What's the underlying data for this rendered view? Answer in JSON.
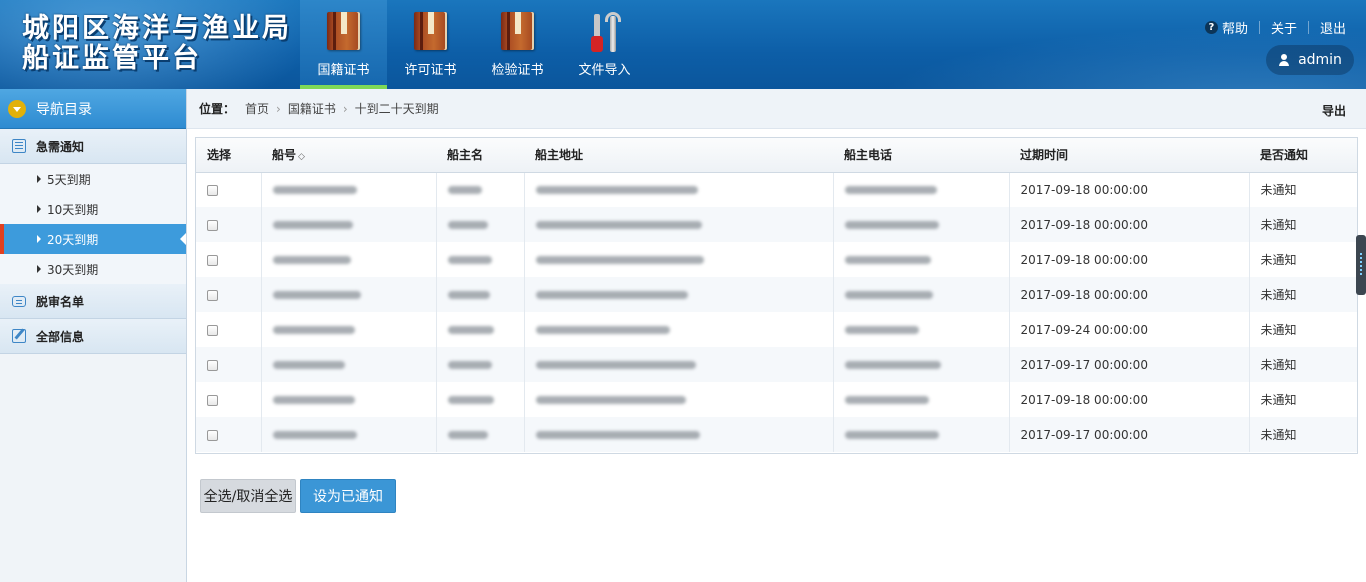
{
  "brand": {
    "line1": "城阳区海洋与渔业局",
    "line2": "船证监管平台"
  },
  "nav": [
    {
      "label": "国籍证书",
      "icon": "book-icon",
      "active": true
    },
    {
      "label": "许可证书",
      "icon": "book-icon",
      "active": false
    },
    {
      "label": "检验证书",
      "icon": "book-icon",
      "active": false
    },
    {
      "label": "文件导入",
      "icon": "tools-icon",
      "active": false
    }
  ],
  "top_links": {
    "help": "帮助",
    "about": "关于",
    "logout": "退出"
  },
  "user": {
    "name": "admin"
  },
  "sidebar": {
    "title": "导航目录",
    "groups": [
      {
        "label": "急需通知",
        "icon": "list-icon"
      },
      {
        "label": "脱审名单",
        "icon": "chat-icon"
      },
      {
        "label": "全部信息",
        "icon": "edit-icon"
      }
    ],
    "subs": [
      {
        "label": "5天到期"
      },
      {
        "label": "10天到期"
      },
      {
        "label": "20天到期"
      },
      {
        "label": "30天到期"
      }
    ]
  },
  "breadcrumb": {
    "label": "位置：",
    "items": [
      "首页",
      "国籍证书",
      "十到二十天到期"
    ],
    "export": "导出"
  },
  "table": {
    "headers": [
      "选择",
      "船号",
      "船主名",
      "船主地址",
      "船主电话",
      "过期时间",
      "是否通知"
    ],
    "rows": [
      {
        "expire": "2017-09-18 00:00:00",
        "notified": "未通知"
      },
      {
        "expire": "2017-09-18 00:00:00",
        "notified": "未通知"
      },
      {
        "expire": "2017-09-18 00:00:00",
        "notified": "未通知"
      },
      {
        "expire": "2017-09-18 00:00:00",
        "notified": "未通知"
      },
      {
        "expire": "2017-09-24 00:00:00",
        "notified": "未通知"
      },
      {
        "expire": "2017-09-17 00:00:00",
        "notified": "未通知"
      },
      {
        "expire": "2017-09-18 00:00:00",
        "notified": "未通知"
      },
      {
        "expire": "2017-09-17 00:00:00",
        "notified": "未通知"
      }
    ]
  },
  "buttons": {
    "select_all": "全选/取消全选",
    "mark_notified": "设为已通知"
  },
  "colors": {
    "header": "#0d5ea7",
    "accent": "#3b96d6",
    "active_underline": "#7ed957",
    "active_marker": "#e04020"
  }
}
